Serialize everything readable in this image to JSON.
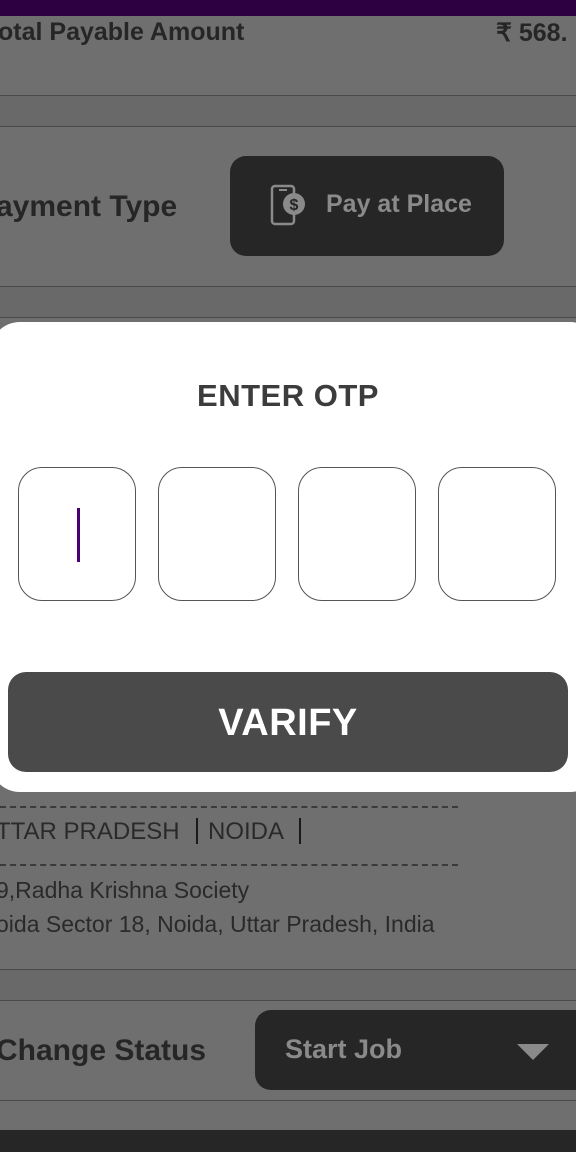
{
  "summary": {
    "total_label": "otal Payable Amount",
    "total_value": "₹ 568."
  },
  "payment": {
    "label": "ayment Type",
    "button_label": "Pay at Place",
    "icon": "phone-dollar-icon"
  },
  "location": {
    "state": "TTAR PRADESH",
    "city": "NOIDA",
    "address_line1": "9,Radha Krishna Society",
    "address_line2": "oida Sector 18, Noida, Uttar Pradesh, India"
  },
  "status": {
    "label": "Change Status",
    "selected": "Start Job",
    "caret_icon": "caret-down-icon"
  },
  "otp_modal": {
    "title": "ENTER OTP",
    "digits": [
      "",
      "",
      "",
      ""
    ],
    "verify_label": "VARIFY"
  },
  "colors": {
    "status_bar": "#2d0042",
    "cursor": "#4a0070",
    "button_dark": "#262626",
    "verify": "#4a4a4a"
  }
}
